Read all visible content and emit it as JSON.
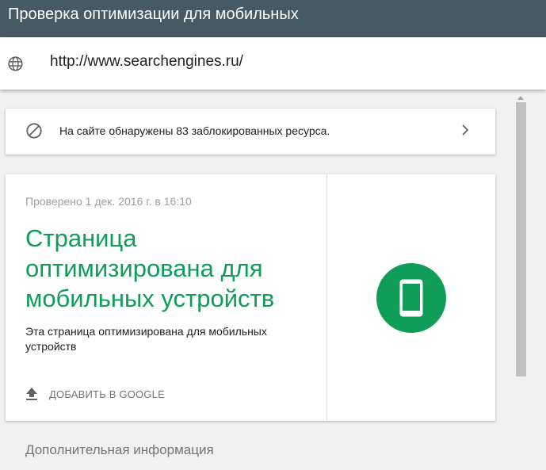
{
  "header": {
    "title": "Проверка оптимизации для мобильных"
  },
  "url_bar": {
    "icon": "globe-icon",
    "value": "http://www.searchengines.ru/"
  },
  "blocked_resources": {
    "icon": "blocked-icon",
    "text": "На сайте обнаружены 83 заблокированных ресурса.",
    "chevron_icon": "chevron-right-icon"
  },
  "result": {
    "checked_at": "Проверено 1 дек. 2016 г. в 16:10",
    "title": "Страница оптимизирована для мобильных устройств",
    "description": "Эта страница оптимизирована для мобильных устройств",
    "add_button_label": "ДОБАВИТЬ В GOOGLE",
    "add_button_icon": "upload-icon",
    "status_icon": "mobile-phone-icon",
    "status_color": "#0f9d58"
  },
  "more_info": {
    "label": "Дополнительная информация"
  },
  "colors": {
    "header_bg": "#455a64",
    "accent_green": "#0f9d58",
    "page_bg": "#f1f1f1"
  }
}
